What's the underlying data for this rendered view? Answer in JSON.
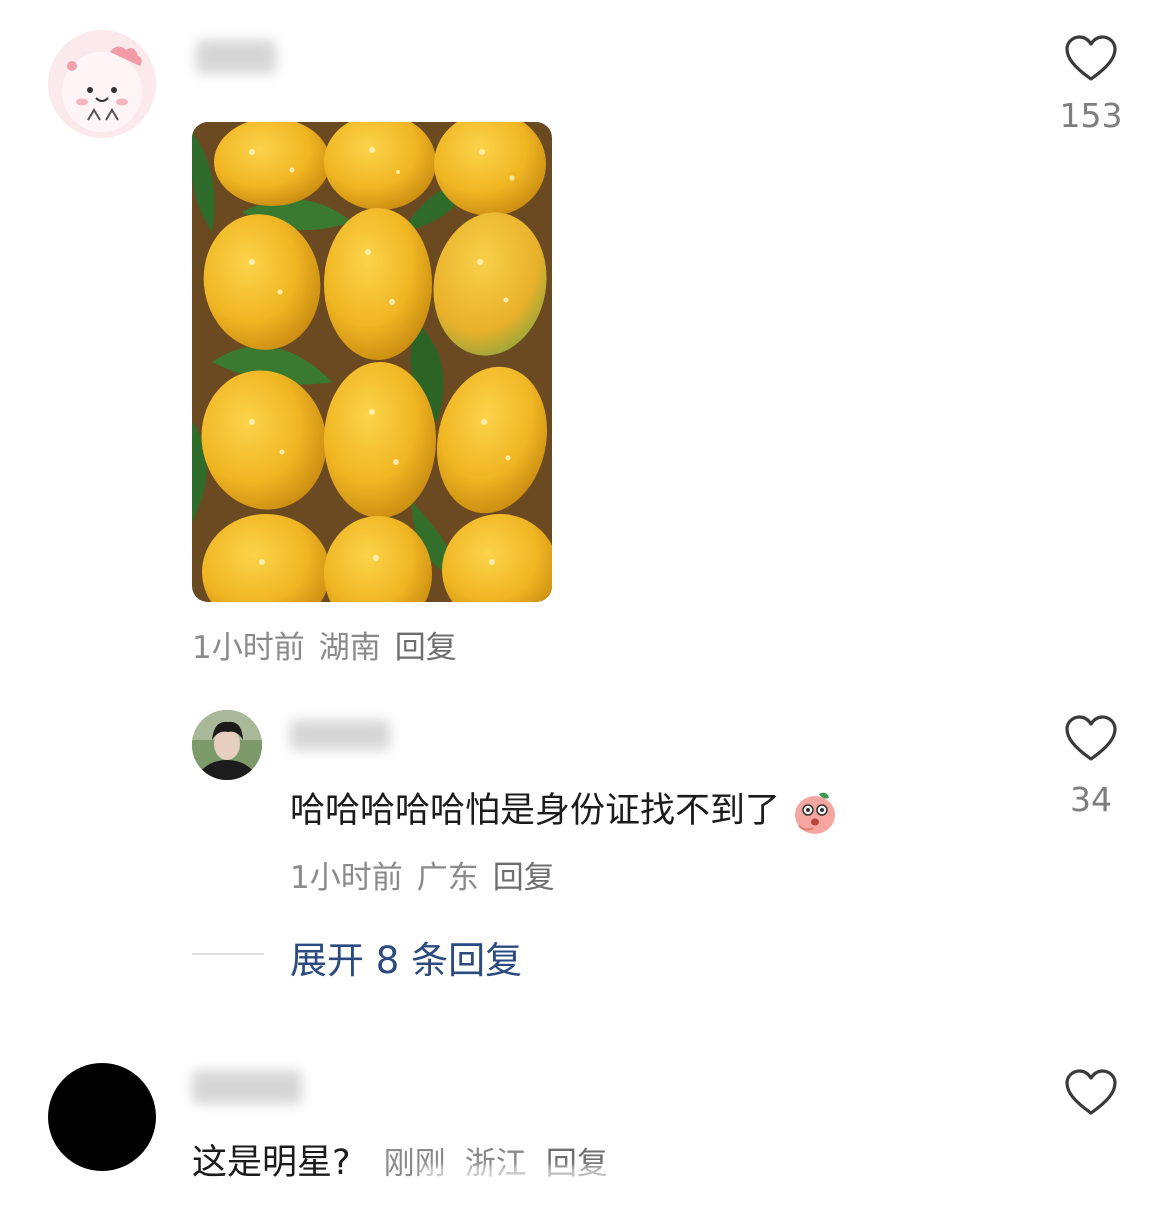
{
  "comments": [
    {
      "likes": "153",
      "meta": {
        "time": "1小时前",
        "location": "湖南",
        "reply": "回复"
      },
      "reply": {
        "text": "哈哈哈哈哈怕是身份证找不到了",
        "likes": "34",
        "meta": {
          "time": "1小时前",
          "location": "广东",
          "reply": "回复"
        }
      },
      "expand_label": "展开 8 条回复"
    },
    {
      "text": "这是明星?",
      "meta": {
        "time": "刚刚",
        "location": "浙江",
        "reply": "回复"
      }
    }
  ],
  "colors": {
    "link": "#2a4a80",
    "meta": "#8a8a8a",
    "mango": "#f0b623",
    "leaf": "#2f6b2a"
  },
  "icons": [
    "heart-icon",
    "mango-face-emoji"
  ]
}
